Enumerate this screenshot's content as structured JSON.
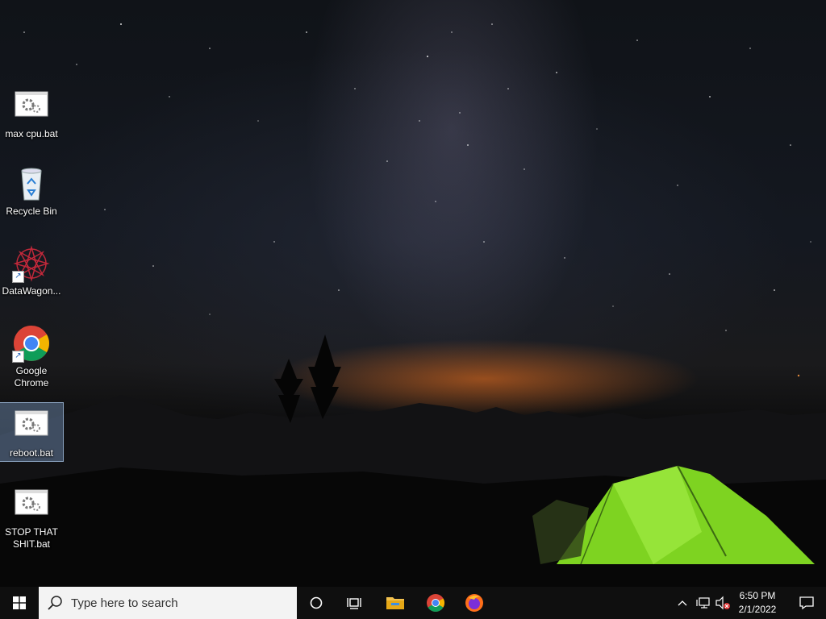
{
  "desktop_icons": [
    {
      "label": "max cpu.bat",
      "icon": "batch-file-icon"
    },
    {
      "label": "Recycle Bin",
      "icon": "recycle-bin-icon"
    },
    {
      "label": "DataWagon...",
      "icon": "datawagon-icon",
      "shortcut": true
    },
    {
      "label": "Google Chrome",
      "icon": "chrome-icon",
      "shortcut": true
    },
    {
      "label": "reboot.bat",
      "icon": "batch-file-icon",
      "selected": true
    },
    {
      "label": "STOP THAT SHIT.bat",
      "icon": "batch-file-icon"
    }
  ],
  "taskbar": {
    "search_placeholder": "Type here to search",
    "pinned": [
      "file-explorer-icon",
      "chrome-icon",
      "firefox-icon"
    ],
    "clock_time": "6:50 PM",
    "clock_date": "2/1/2022"
  },
  "colors": {
    "taskbar_bg": "#0f0f0f",
    "tent_green": "#7ed321",
    "sunset_orange": "#ff7a1a"
  }
}
